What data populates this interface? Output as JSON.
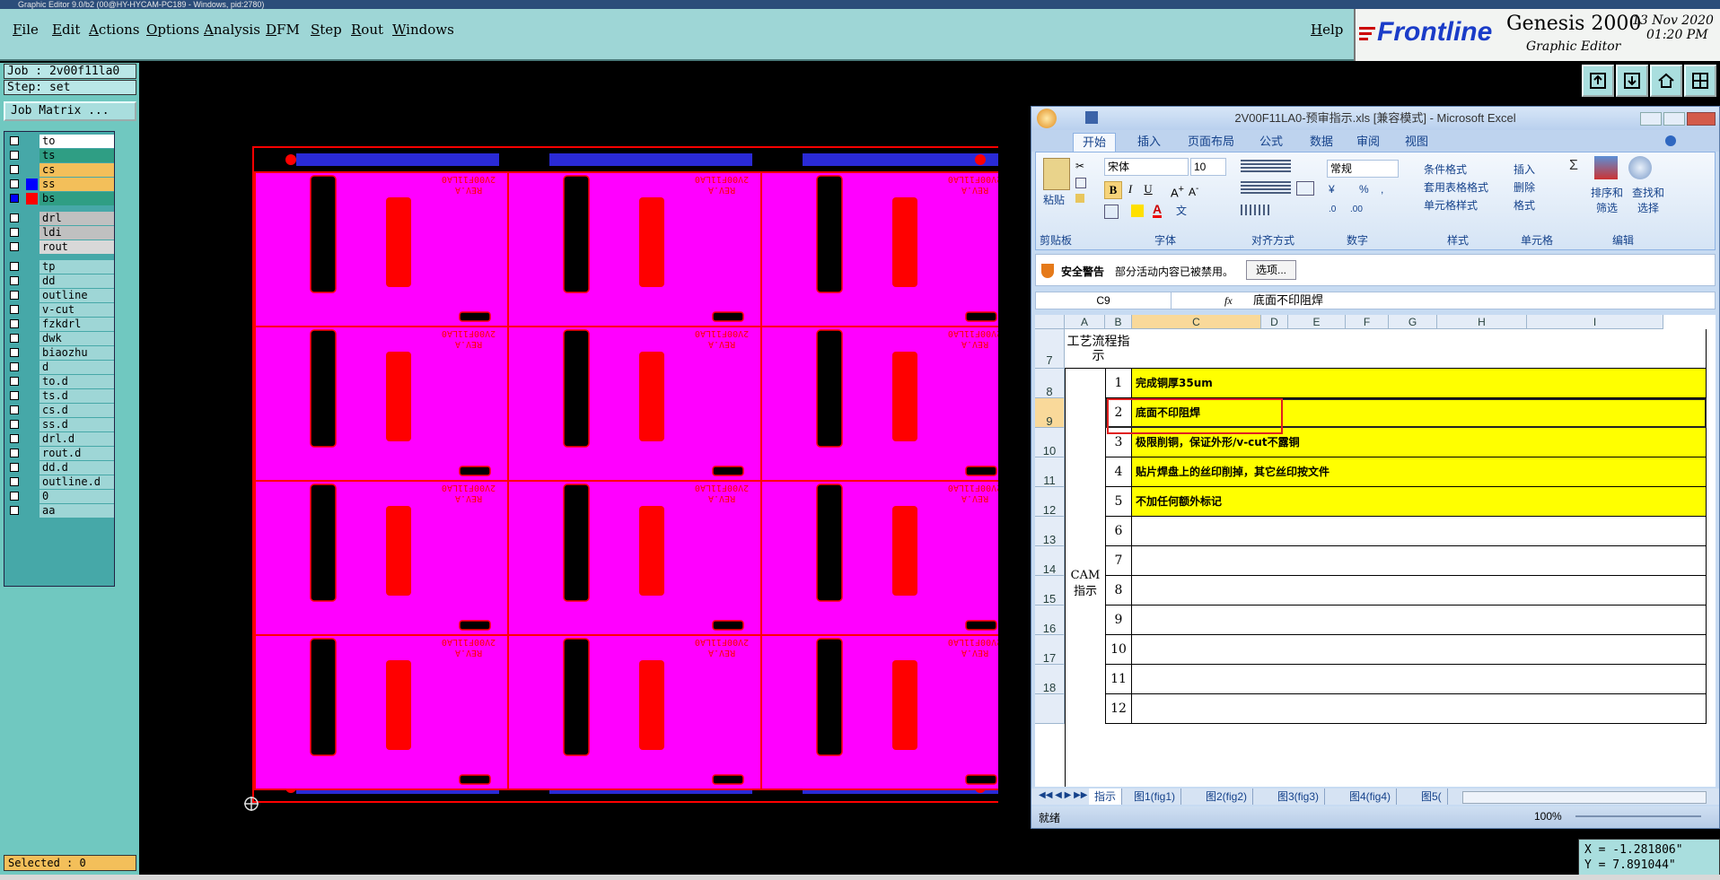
{
  "window": {
    "title": "Graphic Editor 9.0/b2 (00@HY-HYCAM-PC189 - Windows, pid:2780)"
  },
  "menu": {
    "items": [
      "File",
      "Edit",
      "Actions",
      "Options",
      "Analysis",
      "DFM",
      "Step",
      "Rout",
      "Windows"
    ],
    "help": "Help"
  },
  "brand": {
    "logo": "Frontline",
    "product": "Genesis 2000",
    "subtitle": "Graphic Editor",
    "date": "13 Nov 2020",
    "time": "01:20 PM"
  },
  "job": {
    "job_line": "Job : 2v00f11la0",
    "step_line": "Step: set",
    "job_matrix_button": "Job Matrix ..."
  },
  "layers": [
    {
      "name": "to",
      "swatch": "",
      "bg": "#ffffff",
      "on": false
    },
    {
      "name": "ts",
      "swatch": "",
      "bg": "#2f9e84",
      "on": false
    },
    {
      "name": "cs",
      "swatch": "",
      "bg": "#f3bf5a",
      "on": false
    },
    {
      "name": "ss",
      "swatch": "#0000ff",
      "bg": "#f3bf5a",
      "on": false
    },
    {
      "name": "bs",
      "swatch": "#ff0000",
      "bg": "#2f9e84",
      "on": true
    },
    {
      "name": "drl",
      "swatch": "",
      "bg": "#c0c0c0",
      "on": false
    },
    {
      "name": "ldi",
      "swatch": "",
      "bg": "#c0c0c0",
      "on": false
    },
    {
      "name": "rout",
      "swatch": "",
      "bg": "#d8d8d8",
      "on": false
    },
    {
      "name": "tp",
      "swatch": "",
      "bg": "#9ed6d6",
      "on": false
    },
    {
      "name": "dd",
      "swatch": "",
      "bg": "#9ed6d6",
      "on": false
    },
    {
      "name": "outline",
      "swatch": "",
      "bg": "#9ed6d6",
      "on": false
    },
    {
      "name": "v-cut",
      "swatch": "",
      "bg": "#9ed6d6",
      "on": false
    },
    {
      "name": "fzkdrl",
      "swatch": "",
      "bg": "#9ed6d6",
      "on": false
    },
    {
      "name": "dwk",
      "swatch": "",
      "bg": "#9ed6d6",
      "on": false
    },
    {
      "name": "biaozhu",
      "swatch": "",
      "bg": "#9ed6d6",
      "on": false
    },
    {
      "name": "d",
      "swatch": "",
      "bg": "#9ed6d6",
      "on": false
    },
    {
      "name": "to.d",
      "swatch": "",
      "bg": "#9ed6d6",
      "on": false
    },
    {
      "name": "ts.d",
      "swatch": "",
      "bg": "#9ed6d6",
      "on": false
    },
    {
      "name": "cs.d",
      "swatch": "",
      "bg": "#9ed6d6",
      "on": false
    },
    {
      "name": "ss.d",
      "swatch": "",
      "bg": "#9ed6d6",
      "on": false
    },
    {
      "name": "drl.d",
      "swatch": "",
      "bg": "#9ed6d6",
      "on": false
    },
    {
      "name": "rout.d",
      "swatch": "",
      "bg": "#9ed6d6",
      "on": false
    },
    {
      "name": "dd.d",
      "swatch": "",
      "bg": "#9ed6d6",
      "on": false
    },
    {
      "name": "outline.d",
      "swatch": "",
      "bg": "#9ed6d6",
      "on": false
    },
    {
      "name": "0",
      "swatch": "",
      "bg": "#9ed6d6",
      "on": false
    },
    {
      "name": "aa",
      "swatch": "",
      "bg": "#9ed6d6",
      "on": false
    }
  ],
  "status": {
    "selected": "Selected : 0"
  },
  "coords": {
    "x": "X = -1.281806\"",
    "y": "Y = 7.891044\""
  },
  "pcb": {
    "unit_text": "2V00F11LA0",
    "rev": "REV.A",
    "rows": 4,
    "cols": 3,
    "colors": {
      "panel": "#ff00ff",
      "pad": "#ff0000",
      "slot": "#000000",
      "fiducial_band": "#2a2ad6"
    }
  },
  "excel": {
    "title": "2V00F11LA0-预审指示.xls [兼容模式] - Microsoft Excel",
    "tabs": [
      "开始",
      "插入",
      "页面布局",
      "公式",
      "数据",
      "审阅",
      "视图"
    ],
    "ribbon": {
      "paste": "粘贴",
      "font_name": "宋体",
      "font_size": "10",
      "number_format": "常规",
      "conditional": "条件格式",
      "table_format": "套用表格格式",
      "cell_style": "单元格样式",
      "insert": "插入",
      "delete": "删除",
      "format": "格式",
      "sort": "排序和筛选",
      "find": "查找和选择",
      "groups": [
        "剪贴板",
        "字体",
        "对齐方式",
        "数字",
        "样式",
        "单元格",
        "编辑"
      ]
    },
    "security": {
      "label": "安全警告",
      "message": "部分活动内容已被禁用。",
      "button": "选项..."
    },
    "formula": {
      "name_box": "C9",
      "fx": "fx",
      "content": "底面不印阻焊"
    },
    "columns": [
      "A",
      "B",
      "C",
      "D",
      "E",
      "F",
      "G",
      "H",
      "I"
    ],
    "rows": [
      {
        "row": "7",
        "num": "",
        "text": "",
        "yellow": false
      },
      {
        "row": "8",
        "num": "1",
        "text": "完成铜厚35um",
        "yellow": true
      },
      {
        "row": "9",
        "num": "2",
        "text": "底面不印阻焊",
        "yellow": true
      },
      {
        "row": "10",
        "num": "3",
        "text": "极限削铜，保证外形/v-cut不露铜",
        "yellow": true
      },
      {
        "row": "11",
        "num": "4",
        "text": "贴片焊盘上的丝印削掉，其它丝印按文件",
        "yellow": true
      },
      {
        "row": "12",
        "num": "5",
        "text": "不加任何额外标记",
        "yellow": true
      },
      {
        "row": "13",
        "num": "6",
        "text": "",
        "yellow": false
      },
      {
        "row": "14",
        "num": "7",
        "text": "",
        "yellow": false
      },
      {
        "row": "15",
        "num": "8",
        "text": "",
        "yellow": false
      },
      {
        "row": "16",
        "num": "9",
        "text": "",
        "yellow": false
      },
      {
        "row": "17",
        "num": "10",
        "text": "",
        "yellow": false
      },
      {
        "row": "18",
        "num": "11",
        "text": "",
        "yellow": false
      },
      {
        "row": "",
        "num": "12",
        "text": "",
        "yellow": false
      }
    ],
    "label_process": "工艺流程指示",
    "label_cam": "CAM指示",
    "sheets": [
      "指示",
      "图1(fig1)",
      "图2(fig2)",
      "图3(fig3)",
      "图4(fig4)",
      "图5("
    ],
    "status_ready": "就绪",
    "zoom": "100%"
  }
}
